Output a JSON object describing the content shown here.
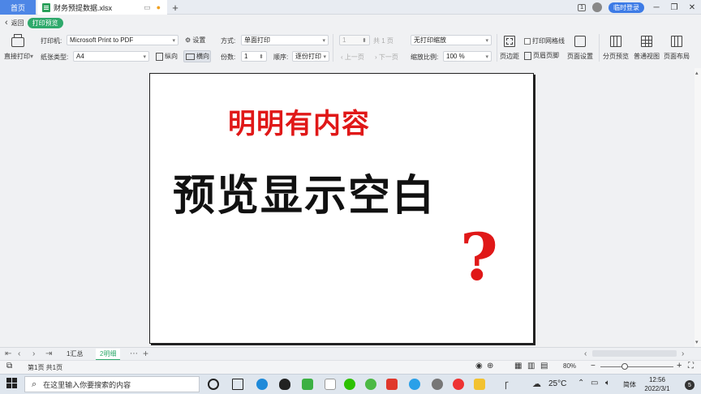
{
  "titlebar": {
    "home_tab": "首页",
    "file_tab": "财务预提数据.xlsx",
    "new_tab_symbol": "+",
    "badge": "1",
    "login_button": "临时登录"
  },
  "printbar": {
    "back": "返回",
    "mode_badge": "打印预览",
    "direct_print": "直接打印",
    "printer_label": "打印机:",
    "printer_value": "Microsoft Print to PDF",
    "settings": "设置",
    "paper_label": "纸张类型:",
    "paper_value": "A4",
    "portrait": "纵向",
    "landscape": "横向",
    "method_label": "方式:",
    "method_value": "单面打印",
    "copies_label": "份数:",
    "copies_value": "1",
    "order_label": "顺序:",
    "order_value": "逐份打印",
    "page_input": "1",
    "total_pages": "共 1 页",
    "prev_page": "上一页",
    "next_page": "下一页",
    "scale_value": "无打印缩放",
    "scale_ratio_label": "缩放比例:",
    "scale_ratio_value": "100 %",
    "margins": "页边距",
    "print_gridlines": "打印网格线",
    "header_footer": "页眉页脚",
    "page_setup": "页面设置",
    "page_break_preview": "分页预览",
    "normal_view": "普通视图",
    "page_layout": "页面布局"
  },
  "preview": {
    "line1": "明明有内容",
    "line2": "预览显示空白",
    "mark": "?"
  },
  "sheets": {
    "tabs": [
      "1汇总",
      "2明细"
    ],
    "active_index": 1
  },
  "status": {
    "page_info": "第1页 共1页",
    "zoom": "80%"
  },
  "taskbar": {
    "search_placeholder": "在这里输入你要搜索的内容",
    "temperature": "25°C",
    "ime": "简体",
    "time": "12:56",
    "date": "2022/3/1",
    "notifications": "5"
  },
  "colors": {
    "accent_blue": "#4d86e6",
    "accent_green": "#2ea96b",
    "preview_red": "#e01818"
  }
}
